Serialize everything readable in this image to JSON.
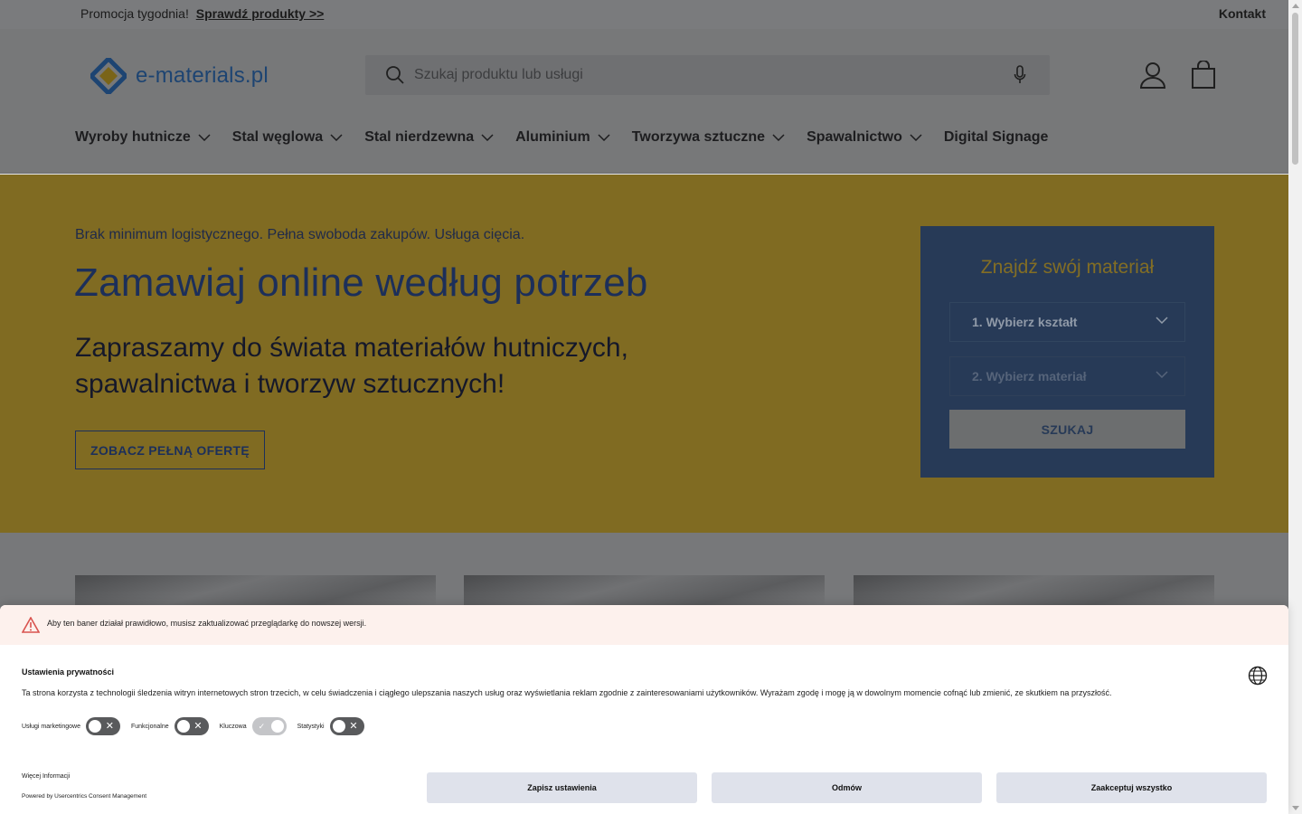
{
  "announcement": {
    "promo_text": "Promocja tygodnia!",
    "promo_link": "Sprawdź produkty >>",
    "contact": "Kontakt"
  },
  "header": {
    "logo_text": "e-materials.pl",
    "search_placeholder": "Szukaj produktu lub usługi",
    "icons": [
      "search-icon",
      "microphone-icon",
      "account-icon",
      "cart-bag-icon"
    ]
  },
  "nav": {
    "items": [
      {
        "label": "Wyroby hutnicze",
        "has_dropdown": true
      },
      {
        "label": "Stal węglowa",
        "has_dropdown": true
      },
      {
        "label": "Stal nierdzewna",
        "has_dropdown": true
      },
      {
        "label": "Aluminium",
        "has_dropdown": true
      },
      {
        "label": "Tworzywa sztuczne",
        "has_dropdown": true
      },
      {
        "label": "Spawalnictwo",
        "has_dropdown": true
      },
      {
        "label": "Digital Signage",
        "has_dropdown": false
      }
    ]
  },
  "hero": {
    "tagline": "Brak minimum logistycznego. Pełna swoboda zakupów. Usługa cięcia.",
    "title": "Zamawiaj online według potrzeb",
    "subtitle": "Zapraszamy do świata materiałów hutniczych, spawalnictwa i tworzyw sztucznych!",
    "cta": "ZOBACZ PEŁNĄ OFERTĘ"
  },
  "finder": {
    "title": "Znajdź swój materiał",
    "select_shape": "1. Wybierz kształt",
    "select_material": "2. Wybierz materiał",
    "search_button": "SZUKAJ"
  },
  "consent": {
    "warning": "Aby ten baner działał prawidłowo, musisz zaktualizować przeglądarkę do nowszej wersji.",
    "title": "Ustawienia prywatności",
    "description": "Ta strona korzysta z technologii śledzenia witryn internetowych stron trzecich, w celu świadczenia i ciągłego ulepszania naszych usług oraz wyświetlania reklam zgodnie z zainteresowaniami użytkowników. Wyrażam zgodę i mogę ją w dowolnym momencie cofnąć lub zmienić, ze skutkiem na przyszłość.",
    "toggles": [
      {
        "label": "Usługi marketingowe",
        "state": "off"
      },
      {
        "label": "Funkcjonalne",
        "state": "off"
      },
      {
        "label": "Kluczowa",
        "state": "on-disabled"
      },
      {
        "label": "Statystyki",
        "state": "off"
      }
    ],
    "more_info": "Więcej Informacji",
    "powered_by": "Powered by Usercentrics Consent Management",
    "buttons": {
      "save": "Zapisz ustawienia",
      "deny": "Odmów",
      "accept": "Zaakceptuj wszystko"
    }
  },
  "colors": {
    "hero_bg": "#806b22",
    "finder_bg": "#273a57",
    "brand_blue": "#1d4472",
    "consent_button": "#dfe2eb"
  }
}
